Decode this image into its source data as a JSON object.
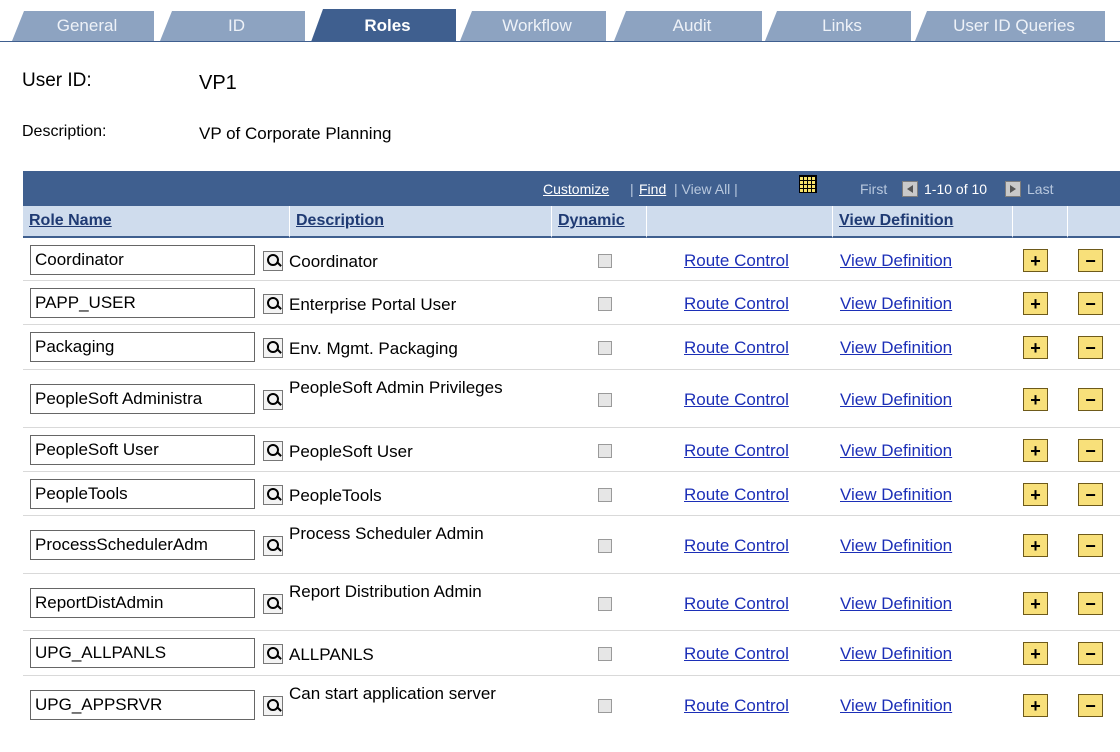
{
  "tabs": [
    {
      "label": "General",
      "active": false
    },
    {
      "label": "ID",
      "active": false
    },
    {
      "label": "Roles",
      "active": true
    },
    {
      "label": "Workflow",
      "active": false
    },
    {
      "label": "Audit",
      "active": false
    },
    {
      "label": "Links",
      "active": false
    },
    {
      "label": "User ID Queries",
      "active": false
    }
  ],
  "user": {
    "id_label": "User ID:",
    "id_value": "VP1",
    "desc_label": "Description:",
    "desc_value": "VP of Corporate Planning"
  },
  "grid": {
    "customize": "Customize",
    "sep1": "|",
    "find": "Find",
    "view_all": "| View All |",
    "first": "First",
    "range": "1-10 of 10",
    "last": "Last",
    "headers": {
      "role_name": "Role Name",
      "description": "Description",
      "dynamic": "Dynamic",
      "view_definition": "View Definition"
    },
    "rows": [
      {
        "role": "Coordinator",
        "desc": "Coordinator",
        "dynamic": false,
        "route": "Route Control",
        "view": "View Definition",
        "plus": "+",
        "minus": "−"
      },
      {
        "role": "PAPP_USER",
        "desc": "Enterprise Portal User",
        "dynamic": false,
        "route": "Route Control",
        "view": "View Definition",
        "plus": "+",
        "minus": "−"
      },
      {
        "role": "Packaging",
        "desc": "Env. Mgmt. Packaging",
        "dynamic": false,
        "route": "Route Control",
        "view": "View Definition",
        "plus": "+",
        "minus": "−"
      },
      {
        "role": "PeopleSoft Administra",
        "desc": "PeopleSoft Admin Privileges",
        "dynamic": false,
        "route": "Route Control",
        "view": "View Definition",
        "plus": "+",
        "minus": "−"
      },
      {
        "role": "PeopleSoft User",
        "desc": "PeopleSoft User",
        "dynamic": false,
        "route": "Route Control",
        "view": "View Definition",
        "plus": "+",
        "minus": "−"
      },
      {
        "role": "PeopleTools",
        "desc": "PeopleTools",
        "dynamic": false,
        "route": "Route Control",
        "view": "View Definition",
        "plus": "+",
        "minus": "−"
      },
      {
        "role": "ProcessSchedulerAdm",
        "desc": "Process Scheduler Admin",
        "dynamic": false,
        "route": "Route Control",
        "view": "View Definition",
        "plus": "+",
        "minus": "−"
      },
      {
        "role": "ReportDistAdmin",
        "desc": "Report Distribution Admin",
        "dynamic": false,
        "route": "Route Control",
        "view": "View Definition",
        "plus": "+",
        "minus": "−"
      },
      {
        "role": "UPG_ALLPANLS",
        "desc": "ALLPANLS",
        "dynamic": false,
        "route": "Route Control",
        "view": "View Definition",
        "plus": "+",
        "minus": "−"
      },
      {
        "role": "UPG_APPSRVR",
        "desc": "Can start application server",
        "dynamic": false,
        "route": "Route Control",
        "view": "View Definition",
        "plus": "+",
        "minus": "−"
      }
    ]
  },
  "colors": {
    "tab_inactive": "#8da3c1",
    "tab_active": "#3f5f8f",
    "grid_header_bg": "#cfdced",
    "link": "#1c2fb7",
    "button_yellow": "#f8e07a"
  }
}
